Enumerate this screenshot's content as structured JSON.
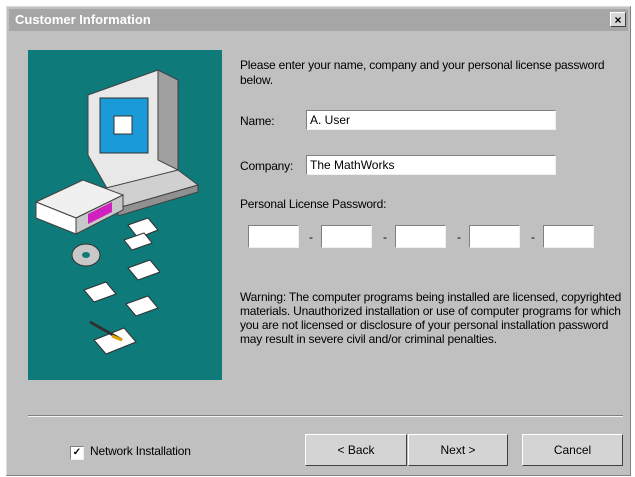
{
  "window": {
    "title": "Customer Information",
    "close_glyph": "×"
  },
  "instructions": "Please enter your name, company and your personal license password below.",
  "form": {
    "name_label": "Name:",
    "name_value": "A. User",
    "company_label": "Company:",
    "company_value": "The MathWorks",
    "password_label": "Personal License Password:",
    "password_separator": "-",
    "password_segments": [
      "",
      "",
      "",
      "",
      ""
    ]
  },
  "warning": "Warning: The computer programs being installed are licensed, copyrighted materials. Unauthorized installation or use of computer programs for which you are not licensed or disclosure of your personal installation password may result in severe civil and/or criminal penalties.",
  "network_install": {
    "label": "Network Installation",
    "checked": true,
    "check_glyph": "✓"
  },
  "buttons": {
    "back": "< Back",
    "next": "Next >",
    "cancel": "Cancel"
  },
  "icons": {
    "illustration": "computer-with-installation-media-icon"
  },
  "colors": {
    "title_bar": "#a6a6a6",
    "dialog_bg": "#c0c0c0",
    "art_bg": "#0f7a7a"
  }
}
